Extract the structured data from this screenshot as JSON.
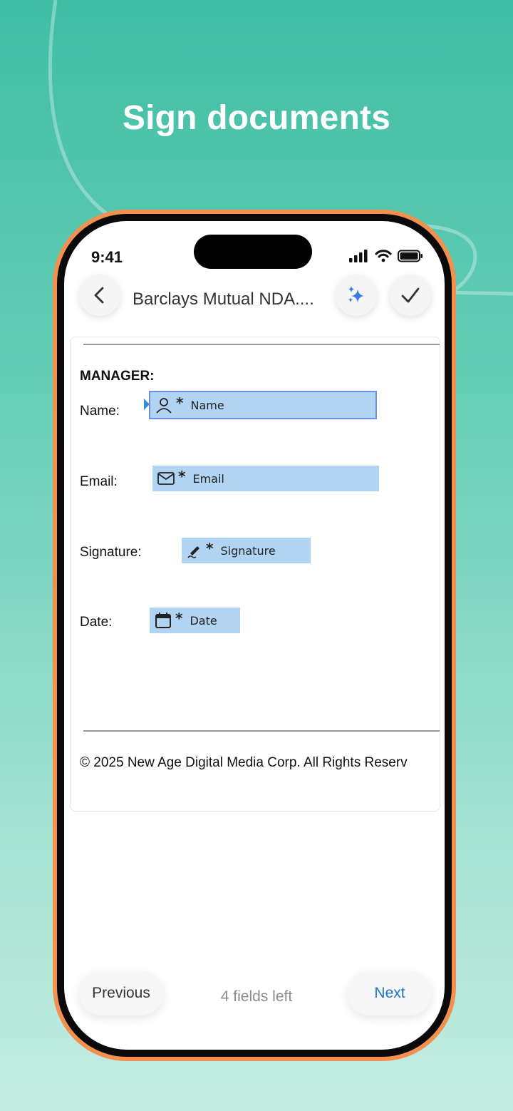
{
  "headline": "Sign documents",
  "status_bar": {
    "time": "9:41"
  },
  "header": {
    "title": "Barclays Mutual NDA...."
  },
  "document": {
    "section_heading": "MANAGER:",
    "fields": [
      {
        "label": "Name:",
        "placeholder": "Name",
        "required_mark": "*",
        "icon": "person-icon"
      },
      {
        "label": "Email:",
        "placeholder": "Email",
        "required_mark": "*",
        "icon": "envelope-icon"
      },
      {
        "label": "Signature:",
        "placeholder": "Signature",
        "required_mark": "*",
        "icon": "pen-icon"
      },
      {
        "label": "Date:",
        "placeholder": "Date",
        "required_mark": "*",
        "icon": "calendar-icon"
      }
    ],
    "copyright": "© 2025 New Age Digital Media Corp. All Rights Reserv"
  },
  "footer": {
    "previous_label": "Previous",
    "fields_left": "4 fields left",
    "next_label": "Next"
  },
  "colors": {
    "background_top": "#3fbea3",
    "phone_frame": "#f3904f",
    "field_fill": "#b1d4f2",
    "accent_blue": "#1a73c9"
  }
}
